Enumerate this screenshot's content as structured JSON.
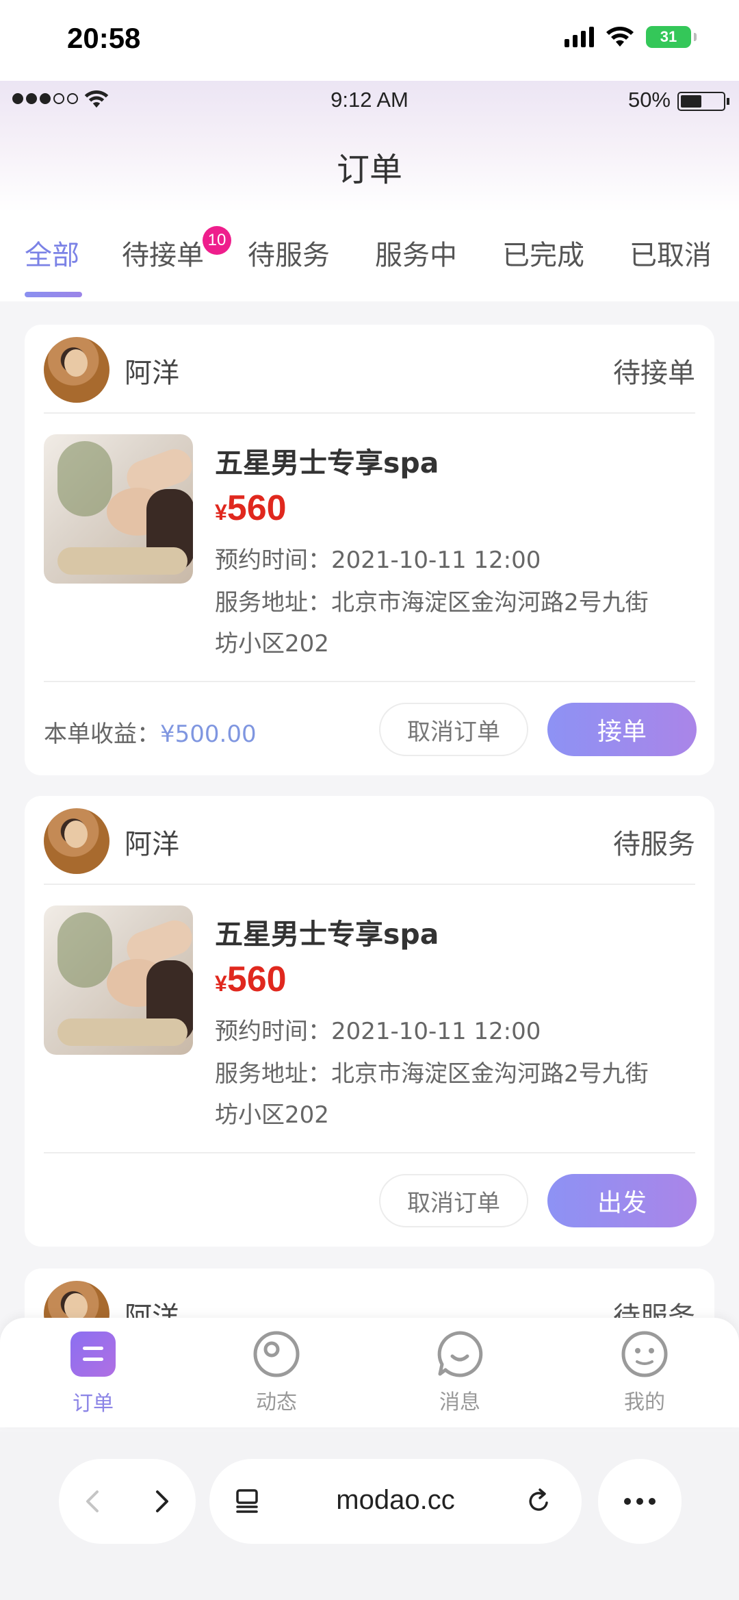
{
  "os_status": {
    "time": "20:58",
    "battery": "31"
  },
  "app_status": {
    "time": "9:12 AM",
    "battery_pct": "50%",
    "battery_level": 0.5
  },
  "header": {
    "title": "订单"
  },
  "tabs": [
    {
      "label": "全部",
      "active": true
    },
    {
      "label": "待接单",
      "badge": "10"
    },
    {
      "label": "待服务"
    },
    {
      "label": "服务中"
    },
    {
      "label": "已完成"
    },
    {
      "label": "已取消"
    }
  ],
  "orders": [
    {
      "user": "阿洋",
      "status": "待接单",
      "service": "五星男士专享spa",
      "currency": "¥",
      "price": "560",
      "time_line": "预约时间：2021-10-11   12:00",
      "address_line1": "服务地址：北京市海淀区金沟河路2号九街",
      "address_line2": "坊小区202",
      "earnings_label": "本单收益：",
      "earnings_amount": "¥500.00",
      "cancel_label": "取消订单",
      "primary_label": "接单"
    },
    {
      "user": "阿洋",
      "status": "待服务",
      "service": "五星男士专享spa",
      "currency": "¥",
      "price": "560",
      "time_line": "预约时间：2021-10-11   12:00",
      "address_line1": "服务地址：北京市海淀区金沟河路2号九街",
      "address_line2": "坊小区202",
      "cancel_label": "取消订单",
      "primary_label": "出发"
    },
    {
      "user": "阿洋",
      "status": "待服务"
    }
  ],
  "tabbar": [
    {
      "label": "订单",
      "icon": "order-icon",
      "active": true
    },
    {
      "label": "动态",
      "icon": "moments-icon"
    },
    {
      "label": "消息",
      "icon": "message-icon"
    },
    {
      "label": "我的",
      "icon": "profile-icon"
    }
  ],
  "browser": {
    "url": "modao.cc"
  }
}
